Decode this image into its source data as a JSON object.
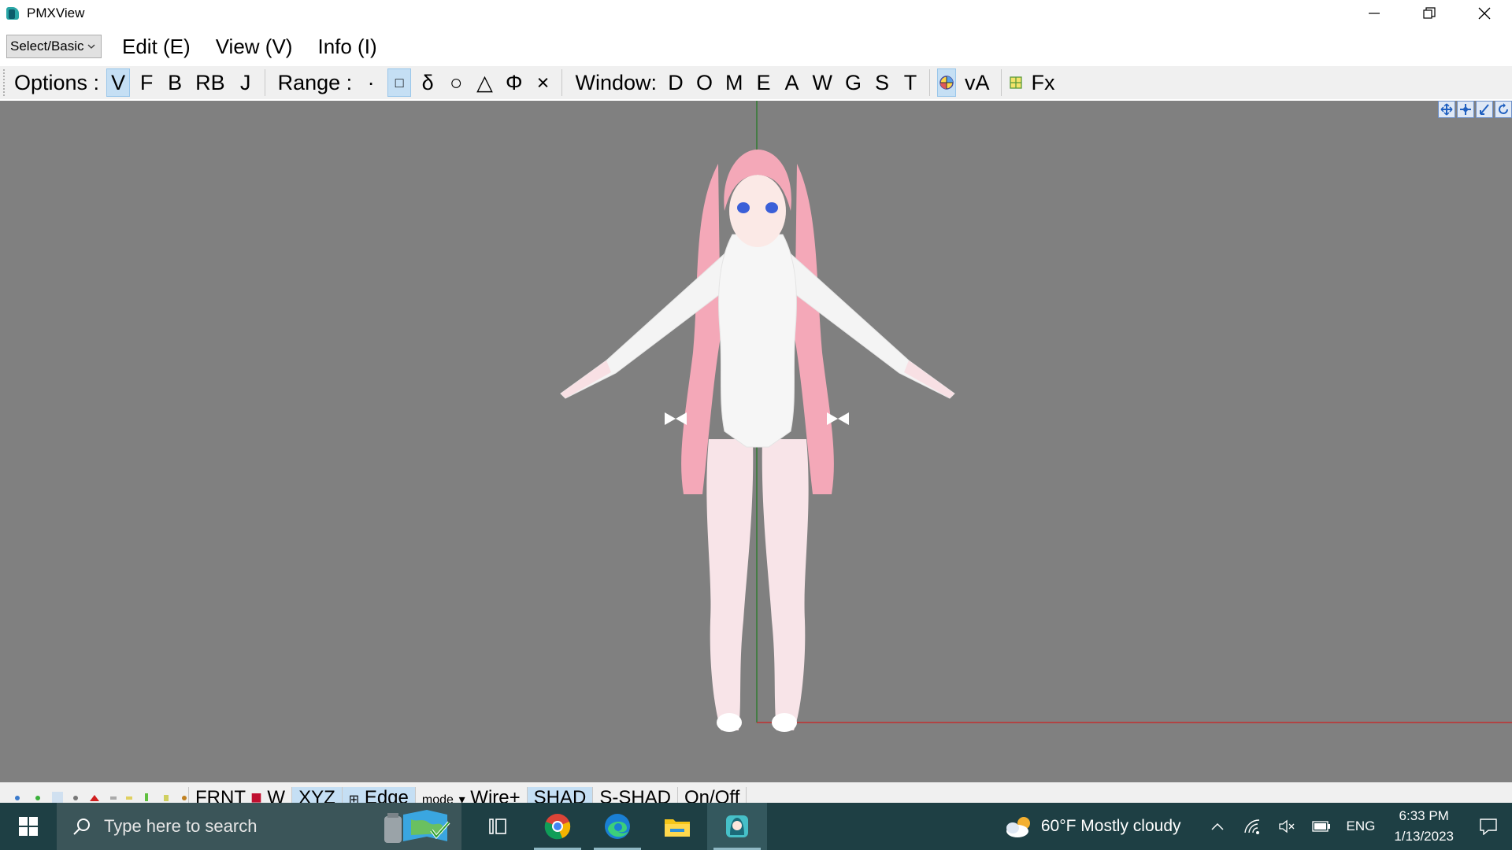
{
  "window": {
    "title": "PMXView"
  },
  "menubar": {
    "mode_select": "Select/Basic",
    "items": [
      "Edit (E)",
      "View (V)",
      "Info (I)"
    ]
  },
  "toolbar": {
    "options_label": "Options :",
    "options": [
      {
        "label": "V",
        "active": true
      },
      {
        "label": "F",
        "active": false
      },
      {
        "label": "B",
        "active": false
      },
      {
        "label": "RB",
        "active": false
      },
      {
        "label": "J",
        "active": false
      }
    ],
    "range_label": "Range :",
    "range": [
      {
        "label": "·",
        "active": false
      },
      {
        "label": "□",
        "active": true
      },
      {
        "label": "δ",
        "active": false
      },
      {
        "label": "○",
        "active": false
      },
      {
        "label": "△",
        "active": false
      },
      {
        "label": "Φ",
        "active": false
      },
      {
        "label": "×",
        "active": false
      }
    ],
    "window_label": "Window:",
    "windows": [
      "D",
      "O",
      "M",
      "E",
      "A",
      "W",
      "G",
      "S",
      "T"
    ],
    "va_label": "vA",
    "fx_label": "Fx"
  },
  "statusbar": {
    "front_label": "FRNT",
    "w_label": "W",
    "xyz_label": "XYZ",
    "edge_label": "Edge",
    "mode_label": "mode",
    "wire_label": "Wire+",
    "shad_label": "SHAD",
    "sshad_label": "S-SHAD",
    "onoff_label": "On/Off"
  },
  "taskbar": {
    "search_placeholder": "Type here to search",
    "weather": "60°F  Mostly cloudy",
    "language": "ENG",
    "time": "6:33 PM",
    "date": "1/13/2023"
  },
  "colors": {
    "viewport_bg": "#808080",
    "axis_y": "#1f7a1f",
    "axis_x": "#cc2020",
    "active_button": "#c5dff4",
    "taskbar_bg": "#1e3f44"
  }
}
